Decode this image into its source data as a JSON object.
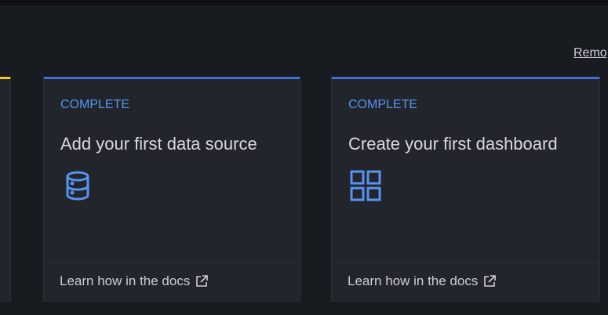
{
  "header": {
    "remove_link": "Remo"
  },
  "cards": [
    {
      "status": "COMPLETE",
      "title": "Add your first data source",
      "icon": "database-icon",
      "link": "Learn how in the docs"
    },
    {
      "status": "COMPLETE",
      "title": "Create your first dashboard",
      "icon": "apps-grid-icon",
      "link": "Learn how in the docs"
    }
  ],
  "colors": {
    "accent": "#5794f2",
    "card_top_complete": "#3d71d9",
    "card_top_partial": "#f2cc0c"
  }
}
